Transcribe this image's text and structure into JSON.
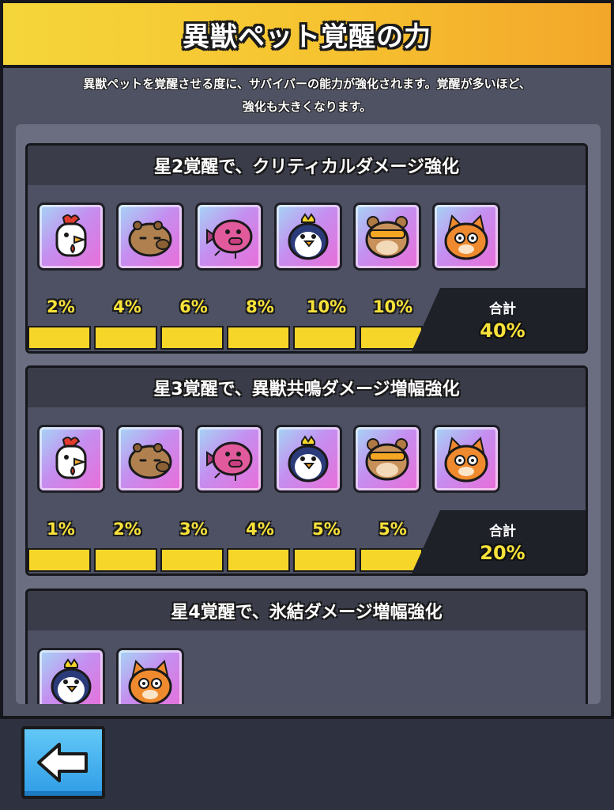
{
  "title": "異獣ペット覚醒の力",
  "description_line1": "異獣ペットを覚醒させる度に、サバイバーの能力が強化されます。覚醒が多いほど、",
  "description_line2": "強化も大きくなります。",
  "cards": [
    {
      "heading": "星2覚醒で、クリティカルダメージ強化",
      "pets": [
        "rooster-icon",
        "capybara-icon",
        "fish-icon",
        "penguin-icon",
        "hamster-icon",
        "cat-icon"
      ],
      "percents": [
        "2%",
        "4%",
        "6%",
        "8%",
        "10%",
        "10%"
      ],
      "total_label": "合計",
      "total_value": "40%"
    },
    {
      "heading": "星3覚醒で、異獣共鳴ダメージ増幅強化",
      "pets": [
        "rooster-icon",
        "capybara-icon",
        "fish-icon",
        "penguin-icon",
        "hamster-icon",
        "cat-icon"
      ],
      "percents": [
        "1%",
        "2%",
        "3%",
        "4%",
        "5%",
        "5%"
      ],
      "total_label": "合計",
      "total_value": "20%"
    },
    {
      "heading": "星4覚醒で、氷結ダメージ増幅強化",
      "pets": [
        "penguin-icon",
        "cat-icon"
      ]
    }
  ],
  "back_button_icon": "arrow-left-icon"
}
